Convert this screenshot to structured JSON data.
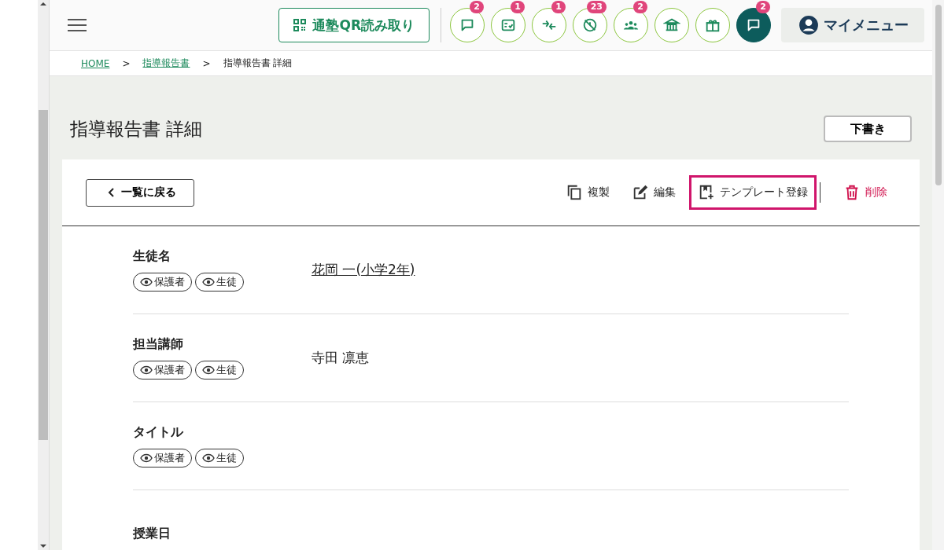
{
  "header": {
    "qr_button": "通塾QR読み取り",
    "icons": [
      {
        "kind": "chat",
        "badge": "2",
        "active": false
      },
      {
        "kind": "checklist",
        "badge": "1",
        "active": false
      },
      {
        "kind": "arrows",
        "badge": "1",
        "active": false
      },
      {
        "kind": "noclock",
        "badge": "23",
        "active": false
      },
      {
        "kind": "people",
        "badge": "2",
        "active": false
      },
      {
        "kind": "bank",
        "active": false
      },
      {
        "kind": "gift",
        "active": false
      },
      {
        "kind": "chat",
        "badge": "2",
        "active": true
      }
    ],
    "my_menu": "マイメニュー"
  },
  "breadcrumb": [
    {
      "label": "HOME",
      "link": true
    },
    {
      "label": "指導報告書",
      "link": true
    },
    {
      "label": "指導報告書 詳細",
      "link": false
    }
  ],
  "breadcrumb_separator": ">",
  "page_title": "指導報告書 詳細",
  "draft_button": "下書き",
  "back_button": "一覧に戻る",
  "actions": [
    {
      "kind": "copy",
      "label": "複製",
      "highlighted": false
    },
    {
      "kind": "edit",
      "label": "編集",
      "highlighted": false
    },
    {
      "kind": "template",
      "label": "テンプレート登録",
      "highlighted": true
    },
    {
      "kind": "delete",
      "label": "削除",
      "highlighted": false
    }
  ],
  "fields": [
    {
      "label": "生徒名",
      "tags": [
        "保護者",
        "生徒"
      ],
      "value": "花岡 一(小学2年)",
      "link": true
    },
    {
      "label": "担当講師",
      "tags": [
        "保護者",
        "生徒"
      ],
      "value": "寺田 凛恵",
      "link": false
    },
    {
      "label": "タイトル",
      "tags": [
        "保護者",
        "生徒"
      ]
    },
    {
      "label": "授業日"
    }
  ]
}
